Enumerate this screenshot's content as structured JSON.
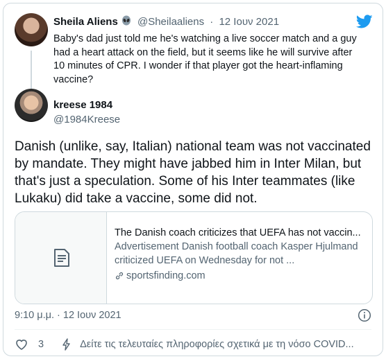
{
  "parent_tweet": {
    "display_name": "Sheila Aliens",
    "handle": "@Sheilaaliens",
    "separator": "·",
    "date": "12 Ιουν 2021",
    "text": "Baby's dad just told me he's watching a live soccer match and a guy had a heart attack on the field, but it seems like he will survive after 10 minutes of CPR. I wonder if that player got the heart-inflaming vaccine?",
    "name_emoji_icon": "alien-icon"
  },
  "tweet": {
    "display_name": "kreese 1984",
    "handle": "@1984Kreese",
    "text": "Danish (unlike, say, Italian) national team was not vaccinated by mandate. They might have jabbed him in Inter Milan, but that's just a speculation. Some of his Inter teammates (like Lukaku) did take a vaccine, some did not.",
    "timestamp": "9:10 μ.μ. · 12 Ιουν 2021"
  },
  "link_card": {
    "title": "The Danish coach criticizes that UEFA has not vaccin...",
    "description": "Advertisement Danish football coach Kasper Hjulmand criticized UEFA on Wednesday for not ...",
    "domain": "sportsfinding.com",
    "thumb_icon": "document-icon",
    "domain_icon": "link-icon"
  },
  "actions": {
    "like_count": "3",
    "covid_info": "Δείτε τις τελευταίες πληροφορίες σχετικά με τη νόσο COVID..."
  },
  "colors": {
    "twitter_blue": "#1d9bf0",
    "text_primary": "#0f1419",
    "text_secondary": "#536471",
    "border": "#cfd9de"
  },
  "icons": [
    "twitter-bird-icon",
    "alien-icon",
    "document-icon",
    "link-icon",
    "info-icon",
    "heart-icon",
    "lightning-icon"
  ]
}
